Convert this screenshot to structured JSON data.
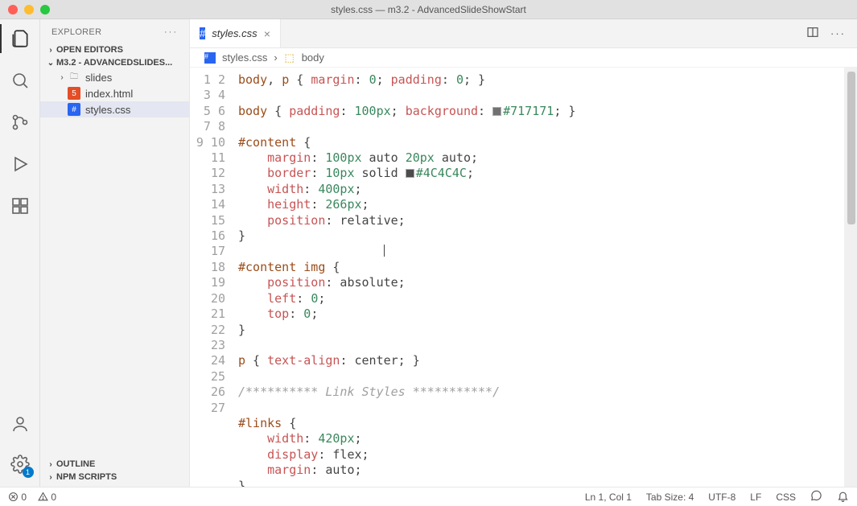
{
  "window": {
    "title": "styles.css — m3.2 - AdvancedSlideShowStart"
  },
  "activity": {
    "badge": "1"
  },
  "explorer": {
    "title": "EXPLORER",
    "sections": {
      "openEditors": "OPEN EDITORS",
      "folder": "M3.2 - ADVANCEDSLIDES...",
      "outline": "OUTLINE",
      "npm": "NPM SCRIPTS"
    },
    "root": {
      "items": [
        {
          "type": "folder",
          "label": "slides"
        },
        {
          "type": "html",
          "label": "index.html"
        },
        {
          "type": "css",
          "label": "styles.css",
          "active": true
        }
      ]
    }
  },
  "tab": {
    "label": "styles.css"
  },
  "breadcrumb": {
    "file": "styles.css",
    "symbol": "body"
  },
  "code": {
    "lines": [
      [
        [
          "sel",
          "body"
        ],
        [
          "punc",
          ", "
        ],
        [
          "sel",
          "p"
        ],
        [
          "punc",
          " { "
        ],
        [
          "prop",
          "margin"
        ],
        [
          "punc",
          ": "
        ],
        [
          "num",
          "0"
        ],
        [
          "punc",
          "; "
        ],
        [
          "prop",
          "padding"
        ],
        [
          "punc",
          ": "
        ],
        [
          "num",
          "0"
        ],
        [
          "punc",
          "; }"
        ]
      ],
      [],
      [
        [
          "sel",
          "body"
        ],
        [
          "punc",
          " { "
        ],
        [
          "prop",
          "padding"
        ],
        [
          "punc",
          ": "
        ],
        [
          "num",
          "100px"
        ],
        [
          "punc",
          "; "
        ],
        [
          "prop",
          "background"
        ],
        [
          "punc",
          ": "
        ],
        [
          "swatch",
          "#717171"
        ],
        [
          "str",
          "#717171"
        ],
        [
          "punc",
          "; }"
        ]
      ],
      [],
      [
        [
          "sel",
          "#content"
        ],
        [
          "punc",
          " {"
        ]
      ],
      [
        [
          "punc",
          "    "
        ],
        [
          "prop",
          "margin"
        ],
        [
          "punc",
          ": "
        ],
        [
          "num",
          "100px"
        ],
        [
          "punc",
          " auto "
        ],
        [
          "num",
          "20px"
        ],
        [
          "punc",
          " auto;"
        ]
      ],
      [
        [
          "punc",
          "    "
        ],
        [
          "prop",
          "border"
        ],
        [
          "punc",
          ": "
        ],
        [
          "num",
          "10px"
        ],
        [
          "punc",
          " solid "
        ],
        [
          "swatch",
          "#4C4C4C"
        ],
        [
          "str",
          "#4C4C4C"
        ],
        [
          "punc",
          ";"
        ]
      ],
      [
        [
          "punc",
          "    "
        ],
        [
          "prop",
          "width"
        ],
        [
          "punc",
          ": "
        ],
        [
          "num",
          "400px"
        ],
        [
          "punc",
          ";"
        ]
      ],
      [
        [
          "punc",
          "    "
        ],
        [
          "prop",
          "height"
        ],
        [
          "punc",
          ": "
        ],
        [
          "num",
          "266px"
        ],
        [
          "punc",
          ";"
        ]
      ],
      [
        [
          "punc",
          "    "
        ],
        [
          "prop",
          "position"
        ],
        [
          "punc",
          ": relative;"
        ]
      ],
      [
        [
          "punc",
          "}"
        ]
      ],
      [
        [
          "caret",
          ""
        ]
      ],
      [
        [
          "sel",
          "#content"
        ],
        [
          "punc",
          " "
        ],
        [
          "sel",
          "img"
        ],
        [
          "punc",
          " {"
        ]
      ],
      [
        [
          "punc",
          "    "
        ],
        [
          "prop",
          "position"
        ],
        [
          "punc",
          ": absolute;"
        ]
      ],
      [
        [
          "punc",
          "    "
        ],
        [
          "prop",
          "left"
        ],
        [
          "punc",
          ": "
        ],
        [
          "num",
          "0"
        ],
        [
          "punc",
          ";"
        ]
      ],
      [
        [
          "punc",
          "    "
        ],
        [
          "prop",
          "top"
        ],
        [
          "punc",
          ": "
        ],
        [
          "num",
          "0"
        ],
        [
          "punc",
          ";"
        ]
      ],
      [
        [
          "punc",
          "}"
        ]
      ],
      [],
      [
        [
          "sel",
          "p"
        ],
        [
          "punc",
          " { "
        ],
        [
          "prop",
          "text-align"
        ],
        [
          "punc",
          ": center; }"
        ]
      ],
      [],
      [
        [
          "cmt",
          "/********** Link Styles ***********/"
        ]
      ],
      [],
      [
        [
          "sel",
          "#links"
        ],
        [
          "punc",
          " {"
        ]
      ],
      [
        [
          "punc",
          "    "
        ],
        [
          "prop",
          "width"
        ],
        [
          "punc",
          ": "
        ],
        [
          "num",
          "420px"
        ],
        [
          "punc",
          ";"
        ]
      ],
      [
        [
          "punc",
          "    "
        ],
        [
          "prop",
          "display"
        ],
        [
          "punc",
          ": flex;"
        ]
      ],
      [
        [
          "punc",
          "    "
        ],
        [
          "prop",
          "margin"
        ],
        [
          "punc",
          ": auto;"
        ]
      ],
      [
        [
          "punc",
          "}"
        ]
      ]
    ]
  },
  "status": {
    "errors": "0",
    "warnings": "0",
    "lnCol": "Ln 1, Col 1",
    "spaces": "Tab Size: 4",
    "encoding": "UTF-8",
    "eol": "LF",
    "lang": "CSS"
  }
}
